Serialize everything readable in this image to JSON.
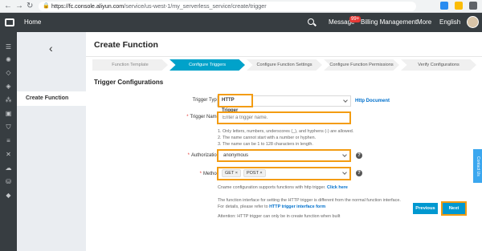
{
  "browser": {
    "url_host": "https://fc.console.aliyun.com",
    "url_path": "/service/us-west-1/my_serverless_service/create/trigger"
  },
  "topnav": {
    "home": "Home",
    "message": "Message",
    "message_badge": "99+",
    "billing": "Billing Management",
    "more": "More",
    "language": "English"
  },
  "sidebar": {
    "back_icon": "chevron-left-icon",
    "item": "Create Function"
  },
  "page": {
    "title": "Create Function",
    "steps": [
      {
        "label": "Function Template",
        "active": false
      },
      {
        "label": "Configure Triggers",
        "active": true
      },
      {
        "label": "Configure Function Settings",
        "active": false
      },
      {
        "label": "Configure Function Permissions",
        "active": false
      },
      {
        "label": "Verify Configurations",
        "active": false
      }
    ],
    "section_title": "Trigger Configurations"
  },
  "form": {
    "trigger_type": {
      "label": "Trigger Type",
      "value": "HTTP Trigger",
      "doc_link": "Http Document"
    },
    "trigger_name": {
      "label": "Trigger Name",
      "placeholder": "Enter a trigger name.",
      "rules": [
        "1. Only letters, numbers, underscores (_), and hyphens (-) are allowed.",
        "2. The name cannot start with a number or hyphen.",
        "3. The name can be 1 to 128 characters in length."
      ]
    },
    "authorization": {
      "label": "Authorization",
      "value": "anonymous"
    },
    "method": {
      "label": "Method",
      "values": [
        "GET",
        "POST"
      ],
      "cname_note": "Cname configuration supports functions with http trigger.",
      "cname_link": "Click here",
      "interface_note_1": "The function interface for setting the HTTP trigger is different from the normal function interface.",
      "interface_note_2": "For details, please refer to",
      "interface_link": "HTTP trigger interface form",
      "attention": "Attention: HTTP trigger can only be in create function when built"
    }
  },
  "buttons": {
    "previous": "Previous",
    "next": "Next"
  },
  "contact": "Contact Us",
  "colors": {
    "accent": "#00a2ca",
    "highlight": "#f39c12",
    "topnav": "#373d41",
    "button": "#0098d0"
  }
}
